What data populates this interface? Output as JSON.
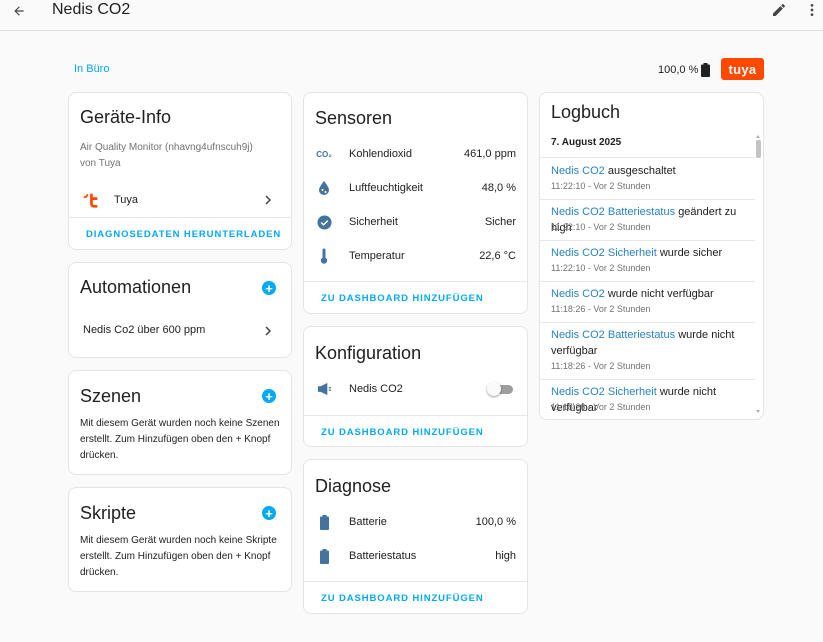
{
  "header": {
    "title": "Nedis CO2"
  },
  "area": {
    "label": "In Büro"
  },
  "battery_top": "100,0 %",
  "brand_logo_text": "tuya",
  "device_info": {
    "title": "Geräte-Info",
    "model": "Air Quality Monitor (nhavng4ufnscuh9j)",
    "manufacturer": "von Tuya",
    "integration": "Tuya",
    "download": "DIAGNOSEDATEN HERUNTERLADEN"
  },
  "automations": {
    "title": "Automationen",
    "items": [
      "Nedis Co2 über 600 ppm"
    ]
  },
  "scenes": {
    "title": "Szenen",
    "empty": "Mit diesem Gerät wurden noch keine Szenen erstellt. Zum Hinzufügen oben den + Knopf drücken."
  },
  "scripts": {
    "title": "Skripte",
    "empty": "Mit diesem Gerät wurden noch keine Skripte erstellt. Zum Hinzufügen oben den + Knopf drücken."
  },
  "sensors": {
    "title": "Sensoren",
    "items": [
      {
        "icon": "co2-icon",
        "name": "Kohlendioxid",
        "value": "461,0 ppm"
      },
      {
        "icon": "humidity-icon",
        "name": "Luftfeuchtigkeit",
        "value": "48,0 %"
      },
      {
        "icon": "check-circle-icon",
        "name": "Sicherheit",
        "value": "Sicher"
      },
      {
        "icon": "thermometer-icon",
        "name": "Temperatur",
        "value": "22,6 °C"
      }
    ],
    "action": "ZU DASHBOARD HINZUFÜGEN"
  },
  "configuration": {
    "title": "Konfiguration",
    "items": [
      {
        "icon": "megaphone-icon",
        "name": "Nedis CO2",
        "state": "off"
      }
    ],
    "action": "ZU DASHBOARD HINZUFÜGEN"
  },
  "diagnostics": {
    "title": "Diagnose",
    "items": [
      {
        "icon": "battery-icon",
        "name": "Batterie",
        "value": "100,0 %"
      },
      {
        "icon": "battery-icon",
        "name": "Batteriestatus",
        "value": "high"
      }
    ],
    "action": "ZU DASHBOARD HINZUFÜGEN"
  },
  "logbook": {
    "title": "Logbuch",
    "date": "7. August 2025",
    "entries": [
      {
        "entity": "Nedis CO2",
        "text": "ausgeschaltet",
        "time": "11:22:10 - Vor 2 Stunden"
      },
      {
        "entity": "Nedis CO2 Batteriestatus",
        "text": "geändert zu high",
        "time": "11:22:10 - Vor 2 Stunden"
      },
      {
        "entity": "Nedis CO2 Sicherheit",
        "text": "wurde sicher",
        "time": "11:22:10 - Vor 2 Stunden"
      },
      {
        "entity": "Nedis CO2",
        "text": "wurde nicht verfügbar",
        "time": "11:18:26 - Vor 2 Stunden"
      },
      {
        "entity": "Nedis CO2 Batteriestatus",
        "text": "wurde nicht verfügbar",
        "time": "11:18:26 - Vor 2 Stunden"
      },
      {
        "entity": "Nedis CO2 Sicherheit",
        "text": "wurde nicht verfügbar",
        "time": "11:18:26 - Vor 2 Stunden"
      }
    ]
  },
  "colors": {
    "accent": "#03a9f4",
    "brand": "#ff4800",
    "icon": "#44739e"
  }
}
